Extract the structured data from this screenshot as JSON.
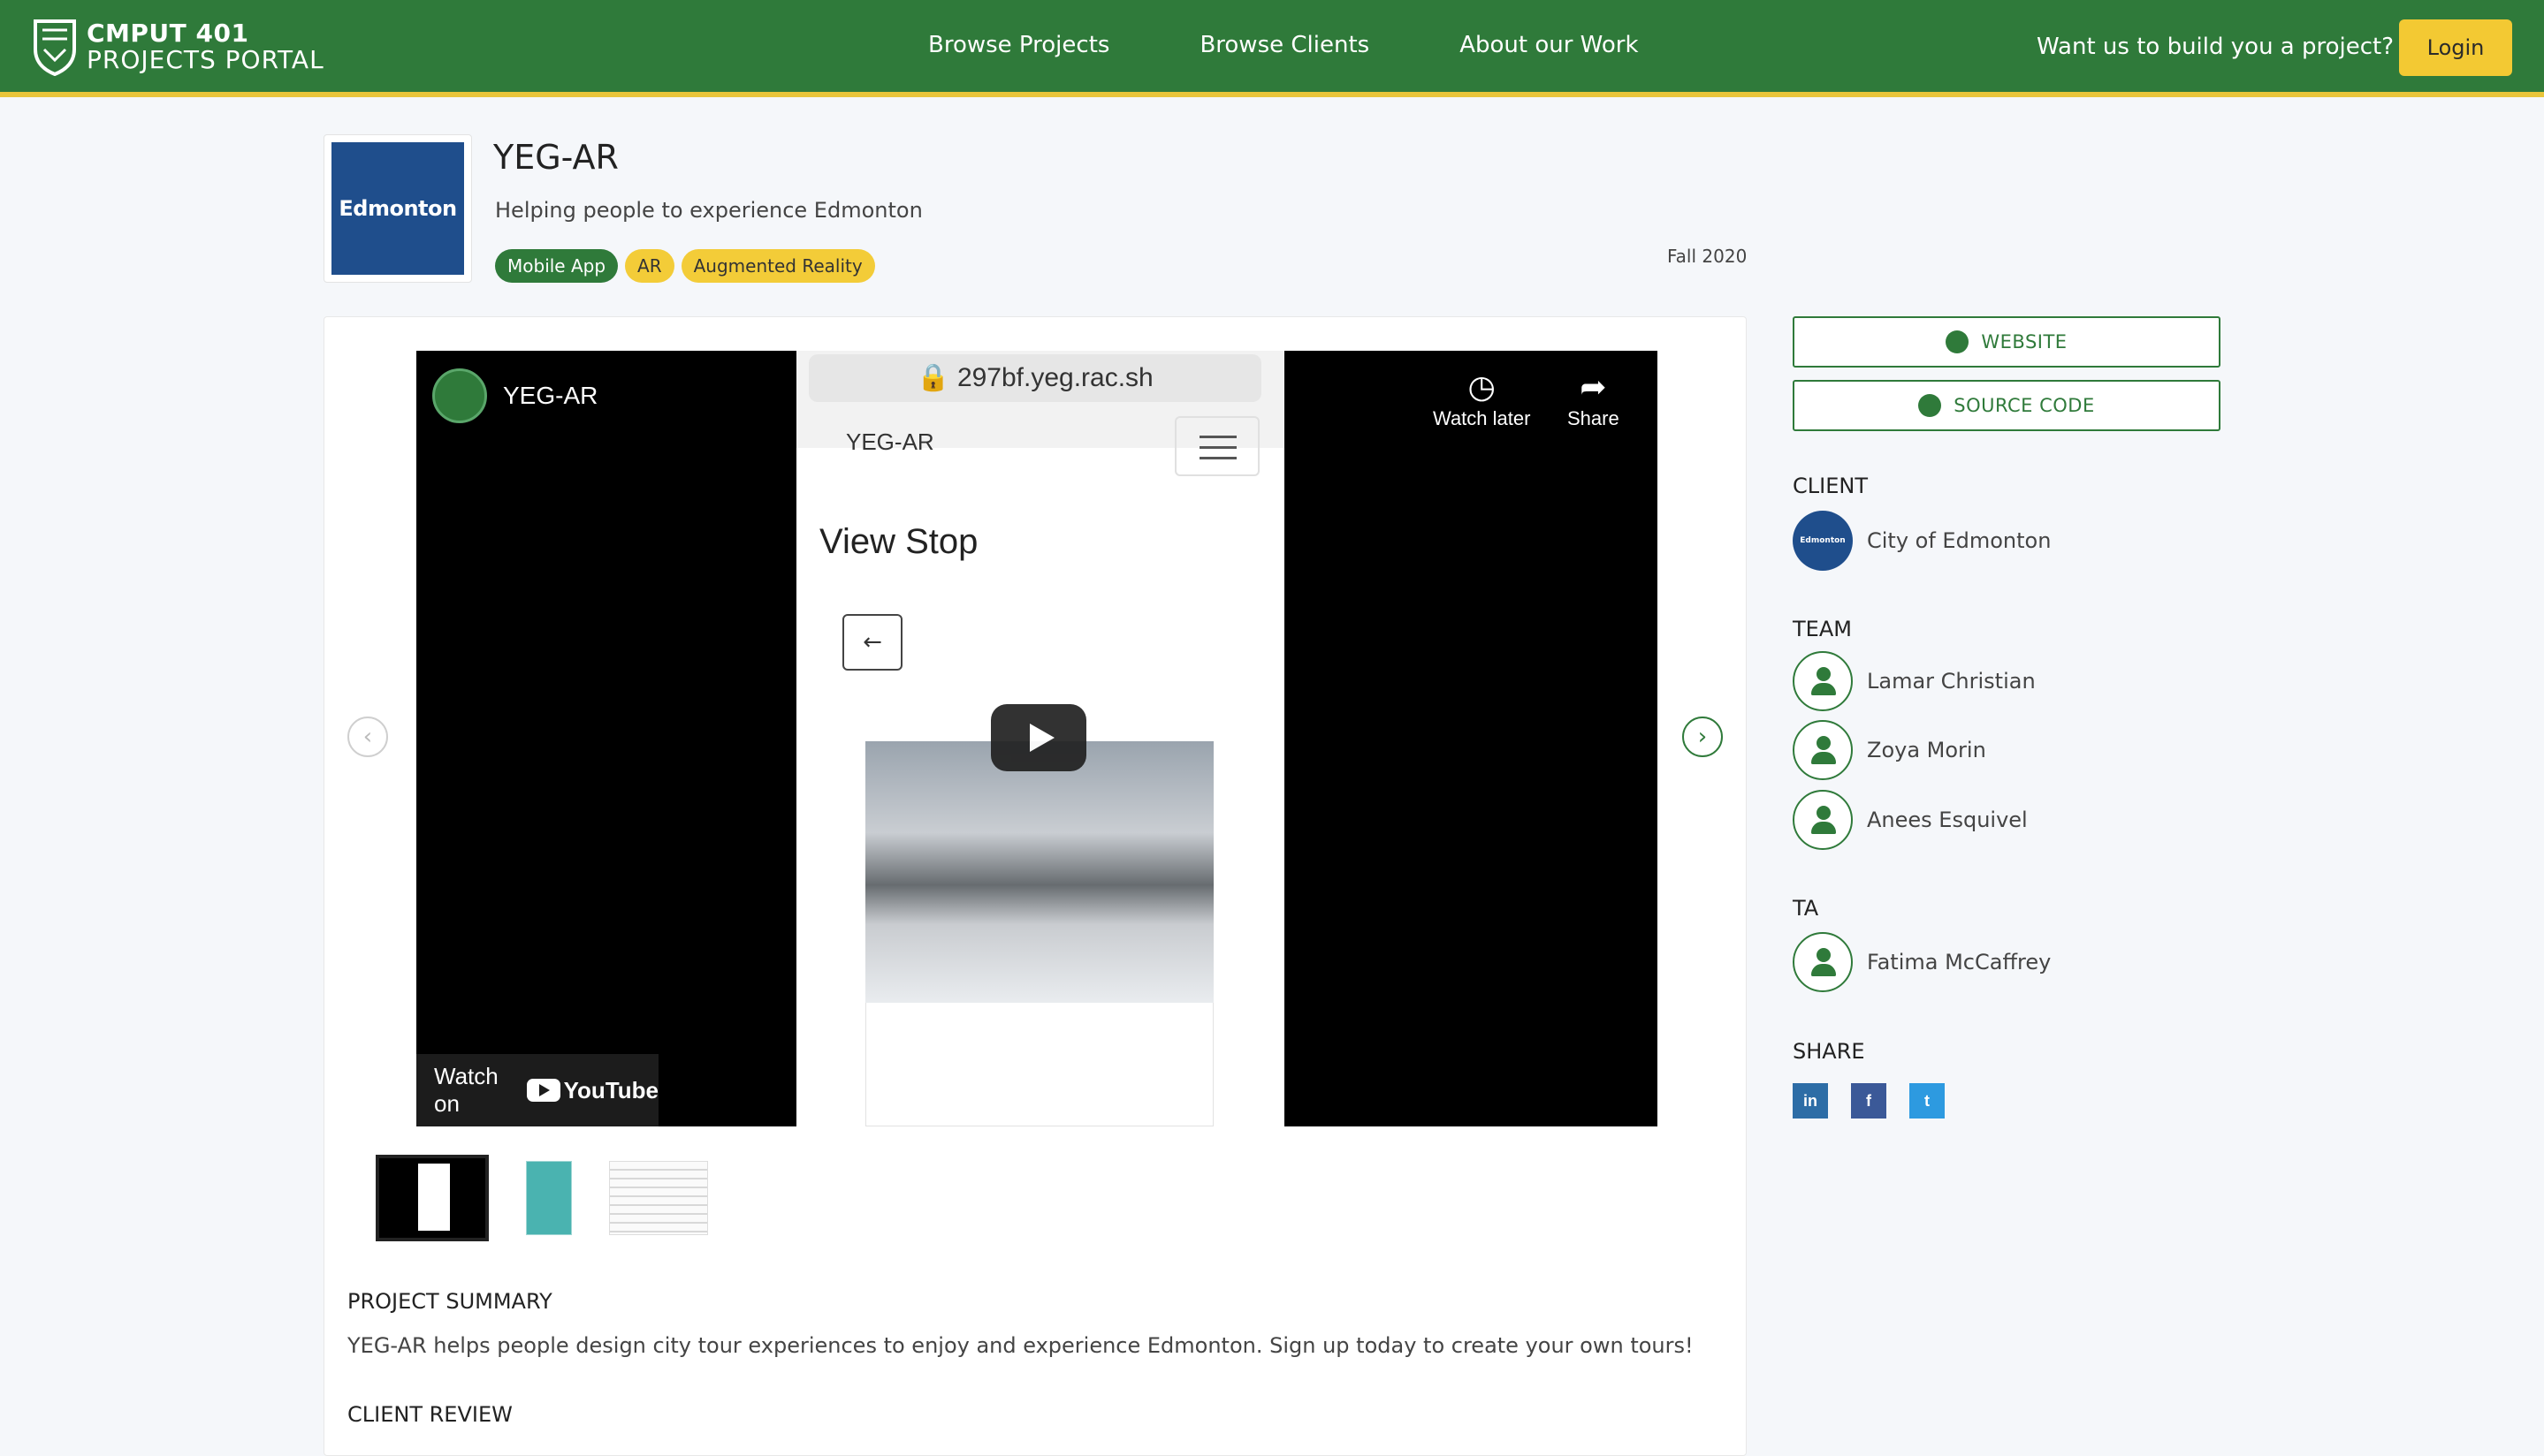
{
  "header": {
    "brand_line1": "CMPUT 401",
    "brand_line2": "PROJECTS PORTAL",
    "nav": [
      "Browse Projects",
      "Browse Clients",
      "About our Work"
    ],
    "cta": "Want us to build you a project?",
    "login": "Login",
    "colors": {
      "bar": "#2f7a3a",
      "accent": "#f3c933"
    }
  },
  "project": {
    "logo_text": "Edmonton",
    "title": "YEG-AR",
    "subtitle": "Helping people to experience Edmonton",
    "tags": [
      "Mobile App",
      "AR",
      "Augmented Reality"
    ],
    "term": "Fall 2020"
  },
  "video": {
    "channel_title": "YEG-AR",
    "watch_later": "Watch later",
    "share": "Share",
    "watch_on": "Watch on",
    "youtube": "YouTube",
    "url": "297bf.yeg.rac.sh",
    "app_name": "YEG-AR",
    "screen_title": "View Stop",
    "back_arrow": "←"
  },
  "carousel": {
    "prev": "‹",
    "next": "›"
  },
  "sections": {
    "summary_title": "PROJECT SUMMARY",
    "summary_text": "YEG-AR helps people design city tour experiences to enjoy and experience Edmonton. Sign up today to create your own tours!",
    "review_title": "CLIENT REVIEW"
  },
  "sidebar": {
    "website": "WEBSITE",
    "source_code": "SOURCE CODE",
    "client_heading": "CLIENT",
    "client_name": "City of Edmonton",
    "client_logo_text": "Edmonton",
    "team_heading": "TEAM",
    "team": [
      "Lamar Christian",
      "Zoya Morin",
      "Anees Esquivel"
    ],
    "ta_heading": "TA",
    "ta": [
      "Fatima McCaffrey"
    ],
    "share_heading": "SHARE",
    "share": [
      {
        "label": "in",
        "color": "#2d6da6"
      },
      {
        "label": "f",
        "color": "#3b5998"
      },
      {
        "label": "t",
        "color": "#2d9ae0"
      }
    ]
  }
}
